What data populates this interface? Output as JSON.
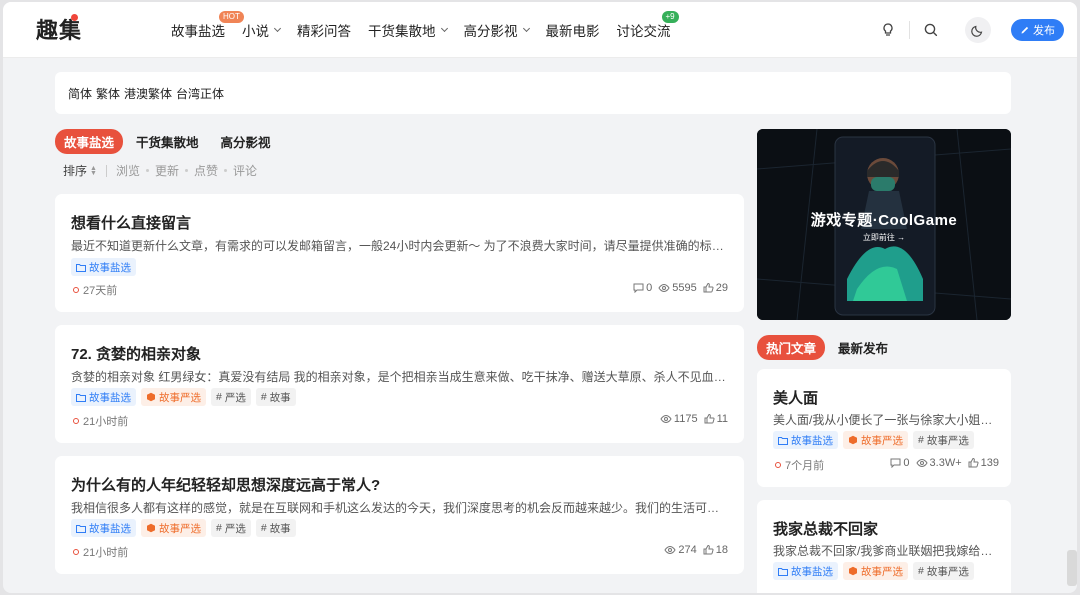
{
  "header": {
    "logo": "趣集",
    "nav": [
      {
        "label": "故事盐选",
        "badge": "HOT",
        "dropdown": false
      },
      {
        "label": "小说",
        "dropdown": true
      },
      {
        "label": "精彩问答",
        "dropdown": false
      },
      {
        "label": "干货集散地",
        "dropdown": true
      },
      {
        "label": "高分影视",
        "dropdown": true
      },
      {
        "label": "最新电影",
        "dropdown": false
      },
      {
        "label": "讨论交流",
        "badge": "+9",
        "dropdown": false
      }
    ],
    "post_button": "发布"
  },
  "langbar": [
    "简体",
    "繁体",
    "港澳繁体",
    "台湾正体"
  ],
  "tabs": [
    "故事盐选",
    "干货集散地",
    "高分影视"
  ],
  "sort": {
    "label": "排序",
    "options": [
      "浏览",
      "更新",
      "点赞",
      "评论"
    ]
  },
  "posts": [
    {
      "title": "想看什么直接留言",
      "excerpt": "最近不知道更新什么文章，有需求的可以发邮箱留言，一般24小时内会更新～ 为了不浪费大家时间，请尽量提供准确的标题或者…",
      "tags": [
        {
          "label": "故事盐选",
          "color": "blue"
        }
      ],
      "time": "27天前",
      "comments": "0",
      "views": "5595",
      "likes": "29"
    },
    {
      "title": "72. 贪婪的相亲对象",
      "excerpt": "贪婪的相亲对象 红男绿女：真爱没有结局 我的相亲对象，是个把相亲当成生意来做、吃干抹净、赠送大草原、杀人不见血的捞…",
      "tags": [
        {
          "label": "故事盐选",
          "color": "blue"
        },
        {
          "label": "故事严选",
          "color": "orange"
        },
        {
          "label": "严选",
          "color": "gray"
        },
        {
          "label": "故事",
          "color": "gray"
        }
      ],
      "time": "21小时前",
      "views": "1175",
      "likes": "11"
    },
    {
      "title": "为什么有的人年纪轻轻却思想深度远高于常人?",
      "excerpt": "我相信很多人都有这样的感觉，就是在互联网和手机这么发达的今天，我们深度思考的机会反而越来越少。我们的生活可能已经…",
      "tags": [
        {
          "label": "故事盐选",
          "color": "blue"
        },
        {
          "label": "故事严选",
          "color": "orange"
        },
        {
          "label": "严选",
          "color": "gray"
        },
        {
          "label": "故事",
          "color": "gray"
        }
      ],
      "time": "21小时前",
      "views": "274",
      "likes": "18"
    }
  ],
  "banner": {
    "title": "游戏专题·CoolGame",
    "subtitle": "立即前往 →"
  },
  "side_tabs": [
    "热门文章",
    "最新发布"
  ],
  "side_posts": [
    {
      "title": "美人面",
      "excerpt": "美人面/我从小便长了一张与徐家大小姐相…",
      "tags": [
        {
          "label": "故事盐选",
          "color": "blue"
        },
        {
          "label": "故事严选",
          "color": "orange"
        },
        {
          "label": "故事严选",
          "color": "gray"
        }
      ],
      "time": "7个月前",
      "comments": "0",
      "views": "3.3W+",
      "likes": "139"
    },
    {
      "title": "我家总裁不回家",
      "excerpt": "我家总裁不回家/我爹商业联姻把我嫁给了…",
      "tags": [
        {
          "label": "故事盐选",
          "color": "blue"
        },
        {
          "label": "故事严选",
          "color": "orange"
        },
        {
          "label": "故事严选",
          "color": "gray"
        }
      ]
    }
  ],
  "colors": {
    "accent": "#e8513d",
    "primary": "#2f7df6",
    "tag_blue": "#2f7df6",
    "tag_orange": "#ee6c2a"
  }
}
